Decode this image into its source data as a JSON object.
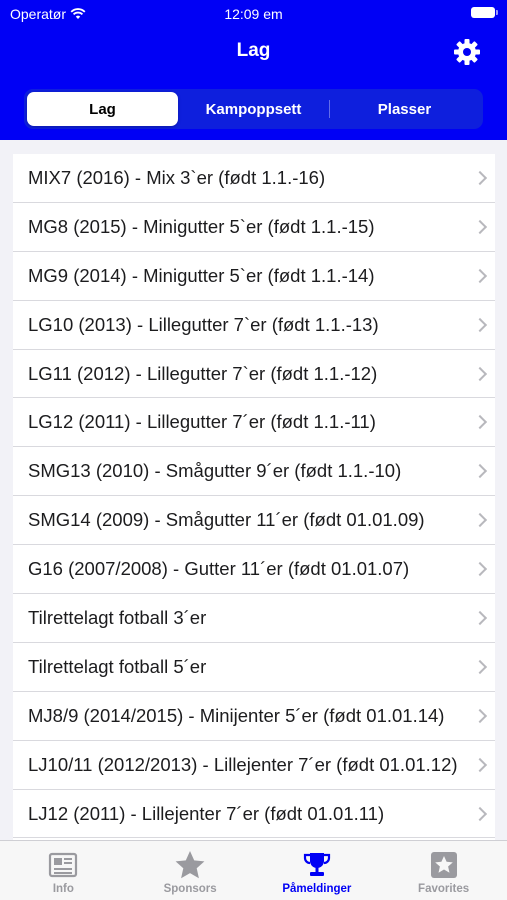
{
  "status_bar": {
    "carrier": "Operatør",
    "time": "12:09 em"
  },
  "nav": {
    "title": "Lag"
  },
  "segments": [
    {
      "label": "Lag",
      "selected": true
    },
    {
      "label": "Kampoppsett",
      "selected": false
    },
    {
      "label": "Plasser",
      "selected": false
    }
  ],
  "teams": [
    "MIX7 (2016) - Mix 3`er (født 1.1.-16)",
    "MG8 (2015) - Minigutter 5`er (født 1.1.-15)",
    "MG9 (2014) - Minigutter 5`er (født 1.1.-14)",
    "LG10 (2013) - Lillegutter 7`er (født 1.1.-13)",
    "LG11 (2012) - Lillegutter 7`er (født 1.1.-12)",
    "LG12 (2011) - Lillegutter 7´er (født 1.1.-11)",
    "SMG13 (2010) - Smågutter 9´er (født 1.1.-10)",
    "SMG14 (2009) - Smågutter 11´er (født 01.01.09)",
    "G16 (2007/2008) - Gutter 11´er (født 01.01.07)",
    "Tilrettelagt fotball 3´er",
    "Tilrettelagt fotball 5´er",
    "MJ8/9 (2014/2015) - Minijenter 5´er (født 01.01.14)",
    "LJ10/11 (2012/2013) - Lillejenter 7´er (født 01.01.12)",
    "LJ12 (2011) - Lillejenter 7´er (født 01.01.11)"
  ],
  "tabs": [
    {
      "label": "Info",
      "icon": "newspaper-icon",
      "active": false
    },
    {
      "label": "Sponsors",
      "icon": "star-icon",
      "active": false
    },
    {
      "label": "Påmeldinger",
      "icon": "trophy-icon",
      "active": true
    },
    {
      "label": "Favorites",
      "icon": "star-square-icon",
      "active": false
    }
  ],
  "colors": {
    "accent": "#0000f5",
    "inactive": "#9a9a9f"
  }
}
